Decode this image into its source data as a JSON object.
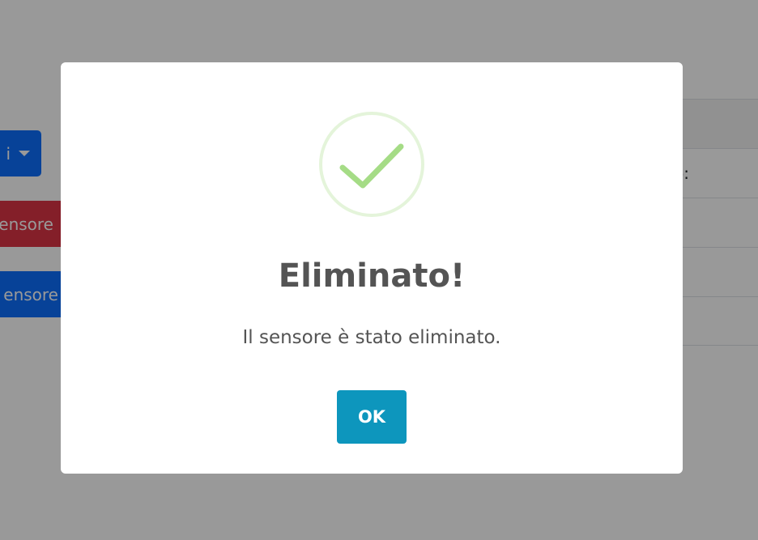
{
  "background": {
    "dropdown_button": {
      "label": "i"
    },
    "delete_button": {
      "label": "ensore",
      "color": "#dc3545"
    },
    "add_button": {
      "label": "ensore",
      "color": "#0d6efd"
    },
    "table": {
      "cell_label": "o:"
    }
  },
  "dialog": {
    "icon": "success-check-icon",
    "title": "Eliminato!",
    "message": "Il sensore è stato eliminato.",
    "confirm_label": "OK",
    "confirm_color": "#0d96bd",
    "success_color": "#a5dc86"
  }
}
